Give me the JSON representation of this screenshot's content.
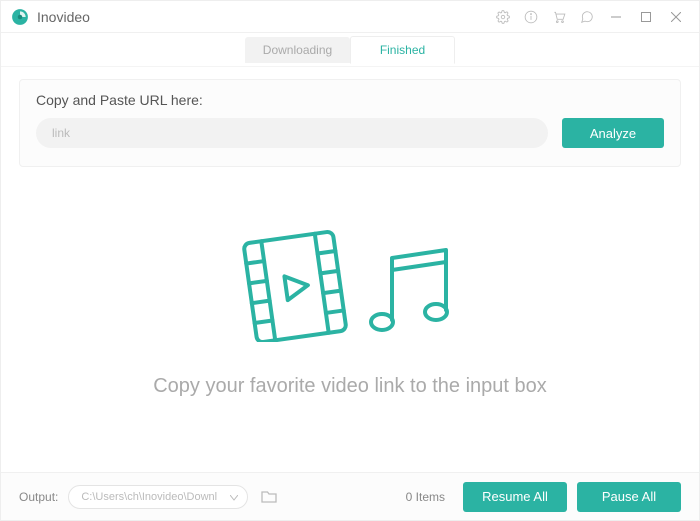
{
  "app": {
    "title": "Inovideo"
  },
  "tabs": {
    "downloading": "Downloading",
    "finished": "Finished"
  },
  "url_panel": {
    "label": "Copy and Paste URL here:",
    "placeholder": "link",
    "analyze": "Analyze"
  },
  "empty": {
    "message": "Copy your favorite video link to the input box"
  },
  "footer": {
    "output_label": "Output:",
    "output_path": "C:\\Users\\ch\\Inovideo\\Downl",
    "items": "0 Items",
    "resume_all": "Resume All",
    "pause_all": "Pause All"
  },
  "colors": {
    "accent": "#2bb3a3"
  }
}
